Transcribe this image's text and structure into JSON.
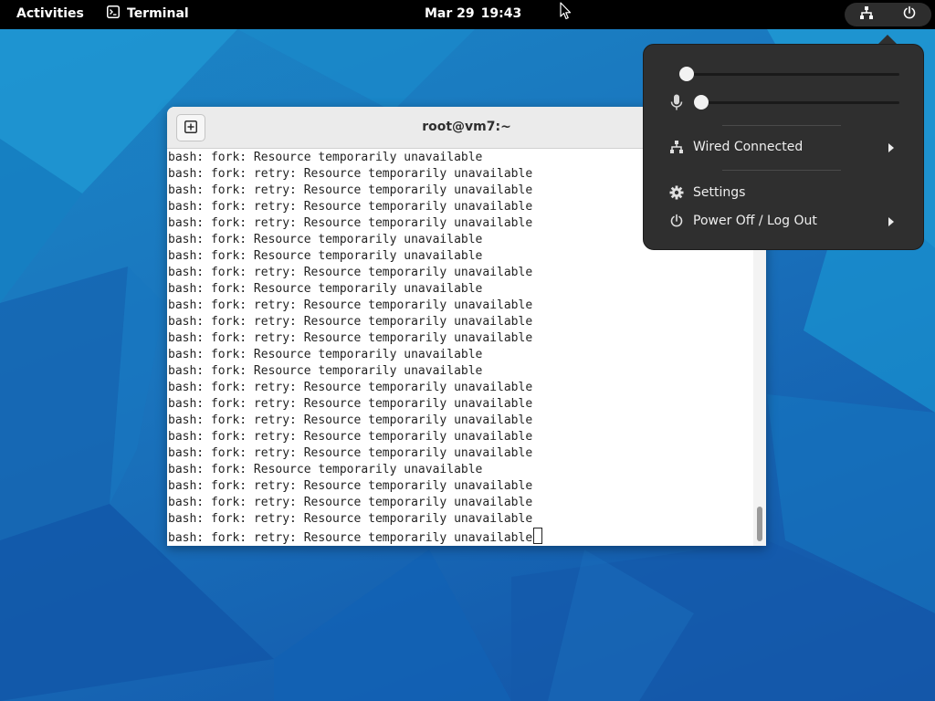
{
  "topbar": {
    "activities_label": "Activities",
    "app_name": "Terminal",
    "clock_date": "Mar 29",
    "clock_time": "19:43",
    "status_icons": [
      "network-wired-icon",
      "power-icon"
    ]
  },
  "terminal": {
    "title": "root@vm7:~",
    "new_tab_icon": "new-tab-icon",
    "scroll_position": 0.95,
    "lines": [
      "bash: fork: Resource temporarily unavailable",
      "bash: fork: retry: Resource temporarily unavailable",
      "bash: fork: retry: Resource temporarily unavailable",
      "bash: fork: retry: Resource temporarily unavailable",
      "bash: fork: retry: Resource temporarily unavailable",
      "bash: fork: Resource temporarily unavailable",
      "bash: fork: Resource temporarily unavailable",
      "bash: fork: retry: Resource temporarily unavailable",
      "bash: fork: Resource temporarily unavailable",
      "bash: fork: retry: Resource temporarily unavailable",
      "bash: fork: retry: Resource temporarily unavailable",
      "bash: fork: retry: Resource temporarily unavailable",
      "bash: fork: Resource temporarily unavailable",
      "bash: fork: Resource temporarily unavailable",
      "bash: fork: retry: Resource temporarily unavailable",
      "bash: fork: retry: Resource temporarily unavailable",
      "bash: fork: retry: Resource temporarily unavailable",
      "bash: fork: retry: Resource temporarily unavailable",
      "bash: fork: retry: Resource temporarily unavailable",
      "bash: fork: Resource temporarily unavailable",
      "bash: fork: retry: Resource temporarily unavailable",
      "bash: fork: retry: Resource temporarily unavailable",
      "bash: fork: retry: Resource temporarily unavailable",
      "bash: fork: retry: Resource temporarily unavailable"
    ]
  },
  "system_menu": {
    "volume_level": 0.0,
    "mic_level": 0.0,
    "mic_icon": "microphone-icon",
    "items": {
      "network_label": "Wired Connected",
      "settings_label": "Settings",
      "power_label": "Power Off / Log Out"
    }
  },
  "colors": {
    "topbar_bg": "#000000",
    "menu_bg": "#2f2f2f",
    "wallpaper_accent": "#1a74bd",
    "terminal_bg": "#ffffff"
  }
}
